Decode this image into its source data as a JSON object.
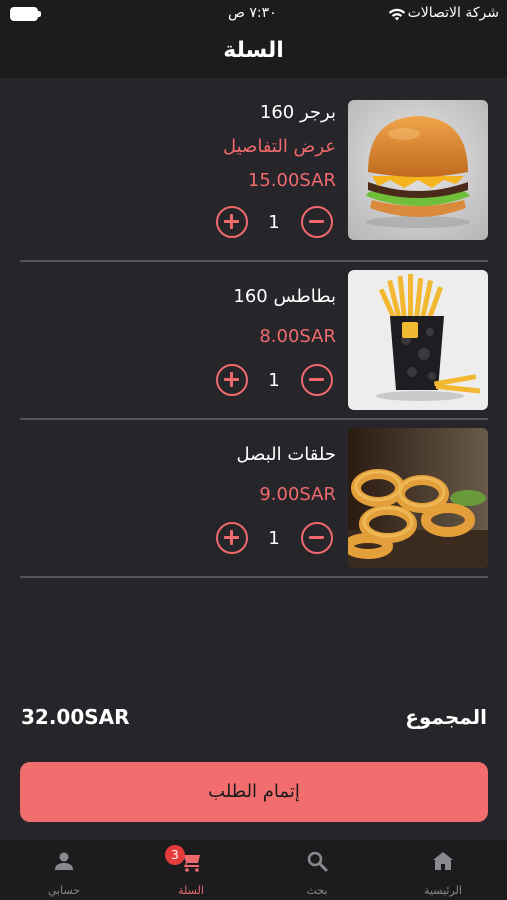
{
  "status_bar": {
    "time": "٧:٣٠ ص",
    "carrier": "شركة الاتصالات"
  },
  "header": {
    "title": "السلة"
  },
  "cart": {
    "items": [
      {
        "name": "برجر 160",
        "details_link": "عرض التفاصيل",
        "price": "15.00SAR",
        "quantity": "1"
      },
      {
        "name": "بطاطس 160",
        "price": "8.00SAR",
        "quantity": "1"
      },
      {
        "name": "حلقات البصل",
        "price": "9.00SAR",
        "quantity": "1"
      }
    ]
  },
  "summary": {
    "total_label": "المجموع",
    "total_value": "32.00SAR",
    "checkout_label": "إتمام الطلب"
  },
  "bottom_nav": {
    "items": [
      {
        "label": "الرئيسية",
        "icon": "home-icon"
      },
      {
        "label": "بحث",
        "icon": "search-icon"
      },
      {
        "label": "السلة",
        "icon": "cart-icon",
        "badge": "3",
        "active": true
      },
      {
        "label": "حسابي",
        "icon": "person-icon"
      }
    ]
  },
  "colors": {
    "background": "#25252a",
    "bar_background": "#1c1c1f",
    "accent": "#f06a6d",
    "checkout_button": "#f26d6e",
    "badge": "#e43b3b",
    "inactive_nav": "#8a8a8e"
  }
}
